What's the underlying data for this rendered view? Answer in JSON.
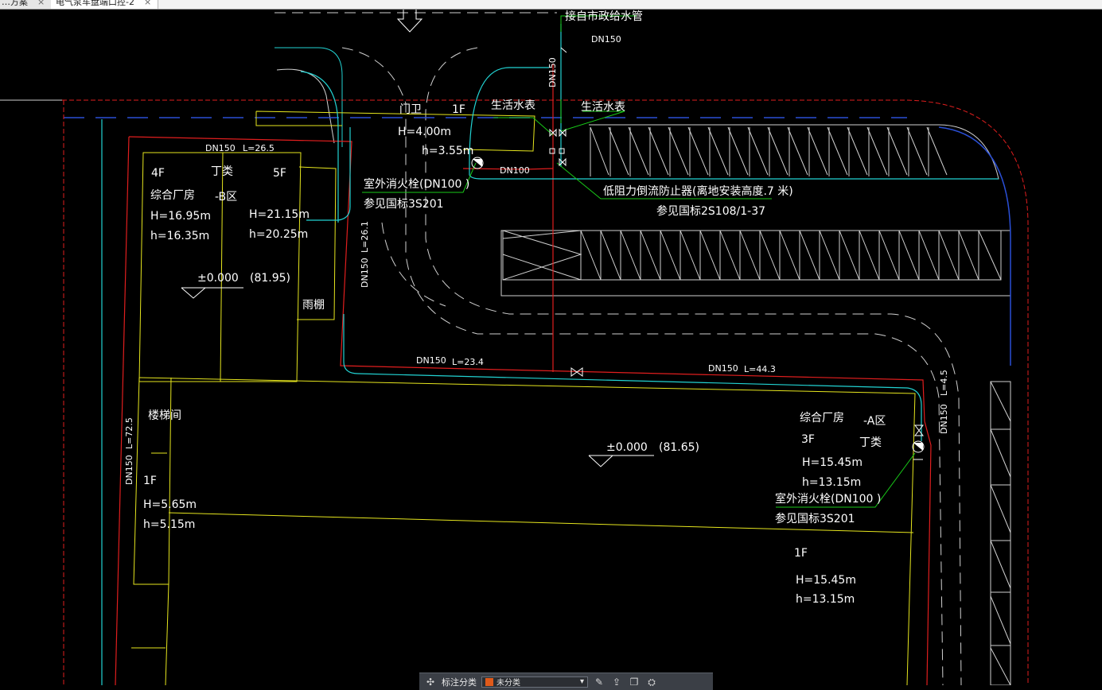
{
  "tabs": [
    {
      "label": "…方案",
      "close": "×"
    },
    {
      "label": "电气泵车盘端口控-2",
      "close": "×"
    }
  ],
  "drawing": {
    "labels": {
      "municipal_pipe": "接自市政给水管",
      "dn150_top": "DN150",
      "dn150_vertical": "DN150",
      "guard_room": "门卫",
      "guard_floor": "1F",
      "guard_H": "H=4.00m",
      "guard_h": "h=3.55m",
      "water_meter_1": "生活水表",
      "water_meter_2": "生活水表",
      "dn100_pipe": "DN100",
      "hydrant_1": "室外消火栓(DN100   )",
      "hydrant_1_ref": "参见国标3S201",
      "backflow": "低阻力倒流防止器(离地安装高度.7 米)",
      "backflow_ref": "参见国标2S108/1-37",
      "dn150_b": "DN150",
      "l_26_5": "L=26.5",
      "b_4f": "4F",
      "b_class_d": "丁类",
      "b_5f": "5F",
      "b_factory": "综合厂房",
      "b_zone": "-B区",
      "b_H1": "H=16.95m",
      "b_h1": "h=16.35m",
      "b_H2": "H=21.15m",
      "b_h2": "h=20.25m",
      "b_level": "±0.000",
      "b_elev": "(81.95)",
      "canopy": "雨棚",
      "dn150_left_v": "DN150",
      "l_26_1": "L=26.1",
      "dn150_mid": "DN150",
      "l_23_4": "L=23.4",
      "dn150_right": "DN150",
      "l_44_3": "L=44.3",
      "stair": "楼梯间",
      "dn150_far_left": "DN150",
      "l_72_5": "L=72.5",
      "s_1f": "1F",
      "s_H": "H=5.65m",
      "s_h": "h=5.15m",
      "a_level": "±0.000",
      "a_elev": "(81.65)",
      "a_factory": "综合厂房",
      "a_zone": "-A区",
      "a_3f": "3F",
      "a_class_d": "丁类",
      "a_H": "H=15.45m",
      "a_h": "h=13.15m",
      "hydrant_2": "室外消火栓(DN100   )",
      "hydrant_2_ref": "参见国标3S201",
      "dn150_right_v": "DN150",
      "l_4_5": "L=4.5",
      "a2_1f": "1F",
      "a2_H": "H=15.45m",
      "a2_h": "h=13.15m"
    }
  },
  "toolbar": {
    "label": "标注分类",
    "selected": "未分类",
    "swatch_color": "#e05a1a"
  },
  "colors": {
    "background": "#000000",
    "building": "#e6e61e",
    "pipe_red": "#e01e1e",
    "pipe_cyan": "#22d3d3",
    "leader_green": "#18c818",
    "road_gray": "#bfbfbf",
    "road_blue": "#2a4fd6"
  }
}
